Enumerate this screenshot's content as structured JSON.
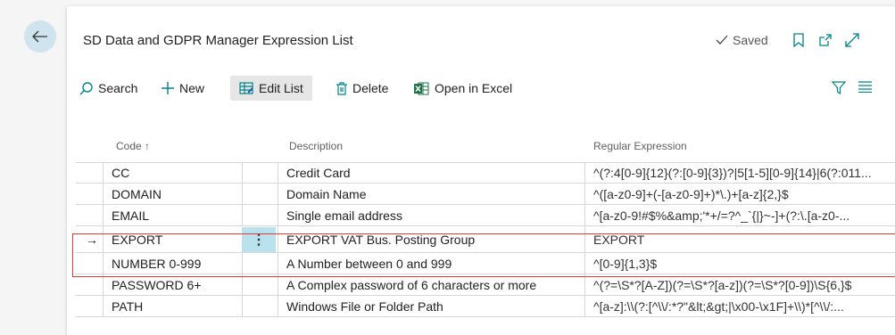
{
  "page": {
    "title": "SD Data and GDPR Manager Expression List",
    "saved_label": "Saved"
  },
  "actions": {
    "search": "Search",
    "new": "New",
    "edit_list": "Edit List",
    "delete": "Delete",
    "open_in_excel": "Open in Excel"
  },
  "table": {
    "columns": [
      "Code ↑",
      "Description",
      "Regular Expression"
    ],
    "rows": [
      {
        "code": "CC",
        "description": "Credit Card",
        "regex": "^(?:4[0-9]{12}(?:[0-9]{3})?|5[1-5][0-9]{14}|6(?:011..."
      },
      {
        "code": "DOMAIN",
        "description": "Domain Name",
        "regex": "^([a-z0-9]+(-[a-z0-9]+)*\\.)+[a-z]{2,}$"
      },
      {
        "code": "EMAIL",
        "description": "Single email address",
        "regex": "^[a-z0-9!#$%&amp;'*+/=?^_`{|}~-]+(?:\\.[a-z0-..."
      },
      {
        "code": "EXPORT",
        "description": "EXPORT VAT Bus. Posting Group",
        "regex": "EXPORT",
        "selected": true
      },
      {
        "code": "NUMBER 0-999",
        "description": "A Number between 0 and 999",
        "regex": "^[0-9]{1,3}$"
      },
      {
        "code": "PASSWORD 6+",
        "description": "A Complex password of 6 characters or more",
        "regex": "^(?=\\S*?[A-Z])(?=\\S*?[a-z])(?=\\S*?[0-9])\\S{6,}$"
      },
      {
        "code": "PATH",
        "description": "Windows File or Folder Path",
        "regex": "^[a-z]:\\\\(?:[^\\\\/:*?\"&lt;&gt;|\\x00-\\x1F]+\\\\)*[^\\\\/:..."
      }
    ]
  },
  "icons": {
    "back": "back-arrow-icon",
    "bookmark": "bookmark-icon",
    "open_new": "open-new-window-icon",
    "expand": "expand-icon",
    "filter": "filter-icon",
    "list_view": "list-view-icon",
    "row_arrow": "→",
    "row_menu": "⋮"
  },
  "colors": {
    "accent": "#008489",
    "selection_highlight": "#e53935",
    "row_menu_bg": "#b7e2ee",
    "back_btn_bg": "#cfe4ee",
    "excel_green": "#1e7145"
  }
}
